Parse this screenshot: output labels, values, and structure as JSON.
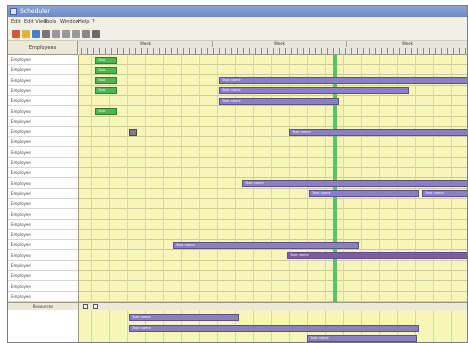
{
  "window": {
    "title": "Scheduler"
  },
  "menu": [
    "Edit",
    "Edit View",
    "Tools",
    "Window",
    "Help",
    "?"
  ],
  "toolbar": [
    "new-icon",
    "open-icon",
    "save-icon",
    "print-icon",
    "cut-icon",
    "copy-icon",
    "paste-icon",
    "undo-icon",
    "filter-icon"
  ],
  "gantt": {
    "corner_label": "Employees",
    "periods": [
      "Week",
      "Week",
      "Week"
    ],
    "rows": [
      "Employee",
      "Employee",
      "Employee",
      "Employee",
      "Employee",
      "Employee",
      "Employee",
      "Employee",
      "Employee",
      "Employee",
      "Employee",
      "Employee",
      "Employee",
      "Employee",
      "Employee",
      "Employee",
      "Employee",
      "Employee",
      "Employee",
      "Employee",
      "Employee",
      "Employee",
      "Employee",
      "Employee"
    ],
    "bars": [
      {
        "row": 0,
        "label": "Task",
        "kind": "green"
      },
      {
        "row": 1,
        "label": "Task",
        "kind": "green"
      },
      {
        "row": 2,
        "label": "Task",
        "kind": "green"
      },
      {
        "row": 2,
        "label": "Task name",
        "kind": "task"
      },
      {
        "row": 3,
        "label": "Task",
        "kind": "green"
      },
      {
        "row": 3,
        "label": "Task name",
        "kind": "task"
      },
      {
        "row": 4,
        "label": "Task name",
        "kind": "task"
      },
      {
        "row": 5,
        "label": "Task",
        "kind": "green"
      },
      {
        "row": 7,
        "label": "",
        "kind": "gray"
      },
      {
        "row": 7,
        "label": "Task name",
        "kind": "task"
      },
      {
        "row": 12,
        "label": "Task name",
        "kind": "task"
      },
      {
        "row": 13,
        "label": "Task name",
        "kind": "task"
      },
      {
        "row": 13,
        "label": "Task name",
        "kind": "task"
      },
      {
        "row": 18,
        "label": "Task name",
        "kind": "task"
      },
      {
        "row": 19,
        "label": "Task name",
        "kind": "task-dark"
      }
    ],
    "bottom_pane_label": "Resources",
    "bottom_bars": [
      {
        "label": "Task name"
      },
      {
        "label": "Task name"
      },
      {
        "label": "Task name"
      }
    ]
  },
  "colors": {
    "chart_bg": "#f7f6b8",
    "task_bar": "#8b80c4",
    "task_bar_dark": "#7e5d9b",
    "milestone_green": "#4cb74f",
    "today_line": "#5bbf6b",
    "titlebar": "#6f88c8"
  }
}
